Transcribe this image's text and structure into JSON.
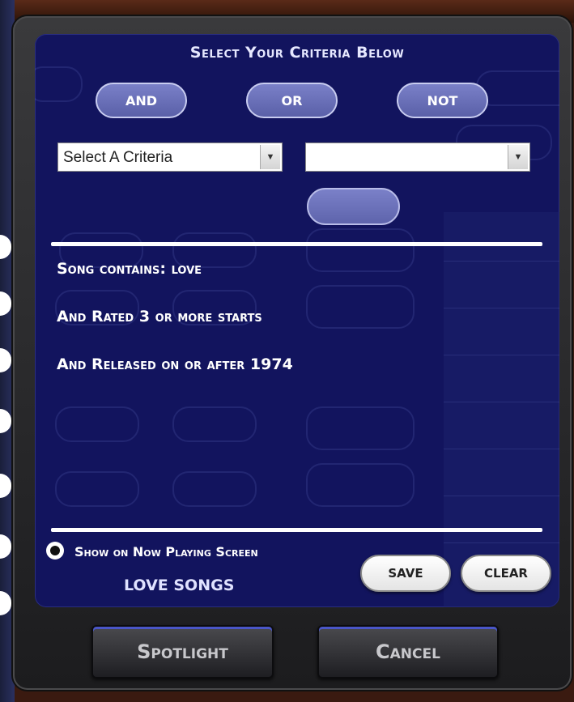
{
  "dialog": {
    "title": "Select Your Criteria Below",
    "logic_buttons": {
      "and": "AND",
      "or": "OR",
      "not": "NOT"
    },
    "criteria_select": {
      "value": "Select A Criteria"
    },
    "value_select": {
      "value": ""
    },
    "criteria_lines": [
      "Song contains: love",
      "And Rated 3 or more starts",
      "And Released on or after 1974"
    ],
    "show_on_now_playing": {
      "label": "Show on Now Playing Screen",
      "selected": true
    },
    "list_name": "LOVE SONGS",
    "save_label": "SAVE",
    "clear_label": "CLEAR"
  },
  "footer": {
    "spotlight_label": "Spotlight",
    "cancel_label": "Cancel"
  },
  "colors": {
    "panel": "#12145e",
    "button_purple": "#6a70b8",
    "text_white": "#ffffff"
  }
}
